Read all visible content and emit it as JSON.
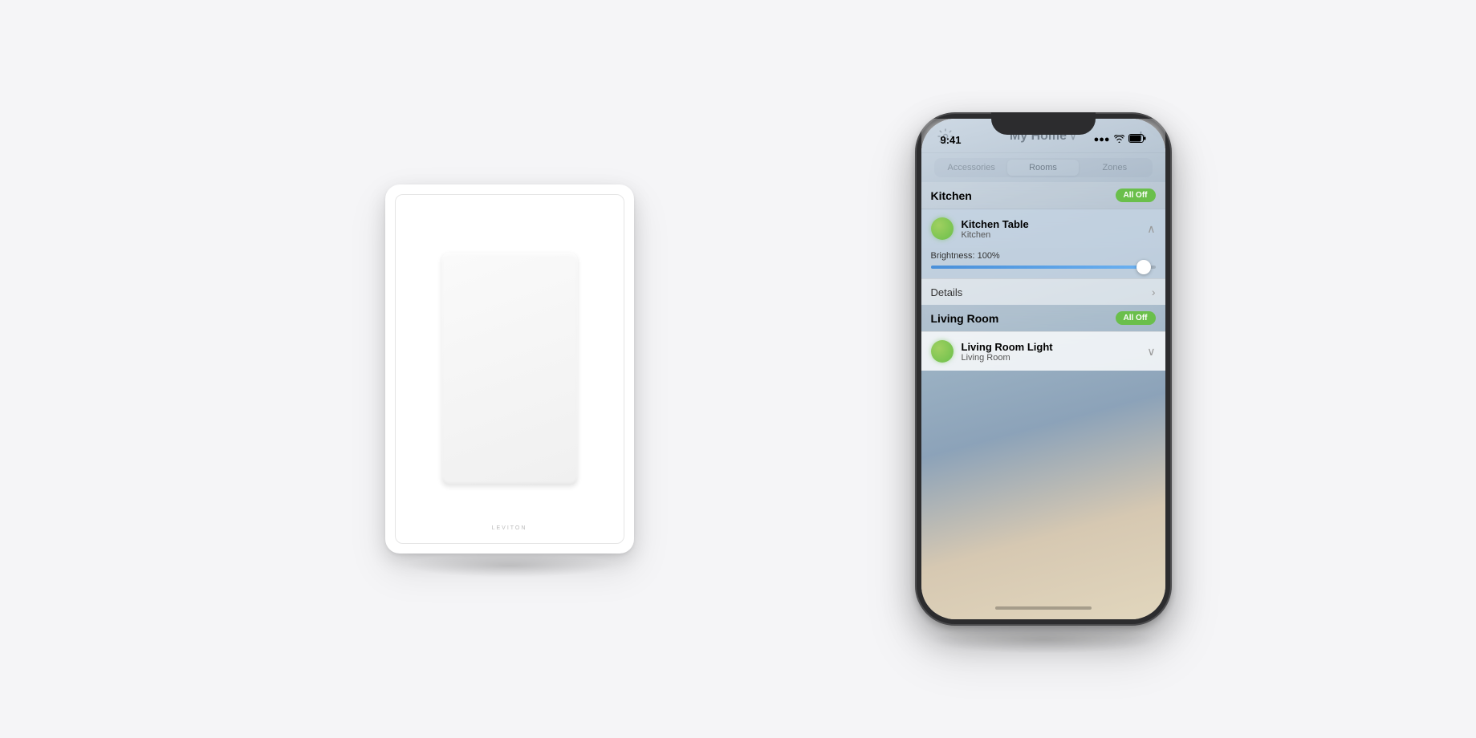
{
  "background_color": "#f5f5f7",
  "switch": {
    "brand": "LEVITON"
  },
  "phone": {
    "status_bar": {
      "time": "9:41",
      "signal_icon": "▌▌▌",
      "wifi_icon": "wifi",
      "battery_icon": "▊"
    },
    "app": {
      "title": "My Home",
      "title_chevron": "∨",
      "settings_icon": "⚙",
      "add_icon": "+",
      "tabs": [
        {
          "label": "Accessories",
          "active": false
        },
        {
          "label": "Rooms",
          "active": true
        },
        {
          "label": "Zones",
          "active": false
        }
      ],
      "rooms": [
        {
          "name": "Kitchen",
          "all_off_label": "All Off",
          "devices": [
            {
              "name": "Kitchen Table",
              "location": "Kitchen",
              "expanded": true,
              "brightness_label": "Brightness: 100%",
              "brightness_value": 100,
              "details_label": "Details"
            }
          ]
        },
        {
          "name": "Living Room",
          "all_off_label": "All Off",
          "devices": [
            {
              "name": "Living Room Light",
              "location": "Living Room",
              "expanded": false
            }
          ]
        }
      ]
    }
  }
}
